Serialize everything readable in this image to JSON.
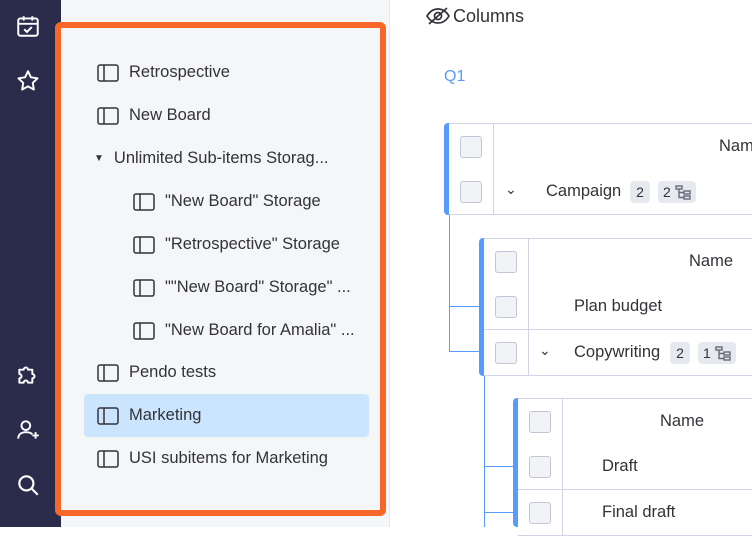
{
  "rail": {
    "icons": [
      "calendar-check-icon",
      "star-icon",
      "puzzle-icon",
      "add-user-icon",
      "search-icon"
    ]
  },
  "sidebar": {
    "items": [
      {
        "label": "Retrospective"
      },
      {
        "label": "New Board"
      },
      {
        "label": "Unlimited Sub-items Storag..."
      },
      {
        "label": "\"New Board\" Storage"
      },
      {
        "label": "\"Retrospective\" Storage"
      },
      {
        "label": "\"\"New Board\" Storage\" ..."
      },
      {
        "label": "\"New Board for Amalia\" ..."
      },
      {
        "label": "Pendo tests"
      },
      {
        "label": "Marketing"
      },
      {
        "label": "USI subitems for Marketing"
      }
    ],
    "active_item": "Marketing"
  },
  "main": {
    "columns_label": "Columns",
    "group_title": "Q1",
    "level1": {
      "header": "Nam",
      "rows": [
        {
          "name": "Campaign",
          "count": "2",
          "sub_count": "2"
        }
      ]
    },
    "level2": {
      "header": "Name",
      "rows": [
        {
          "name": "Plan budget"
        },
        {
          "name": "Copywriting",
          "count": "2",
          "sub_count": "1"
        }
      ]
    },
    "level3": {
      "header": "Name",
      "rows": [
        {
          "name": "Draft"
        },
        {
          "name": "Final draft"
        }
      ]
    }
  },
  "colors": {
    "rail_bg": "#2b2c4c",
    "accent": "#579bfc",
    "highlight_border": "#f7672a",
    "active_item_bg": "#cce5ff"
  }
}
